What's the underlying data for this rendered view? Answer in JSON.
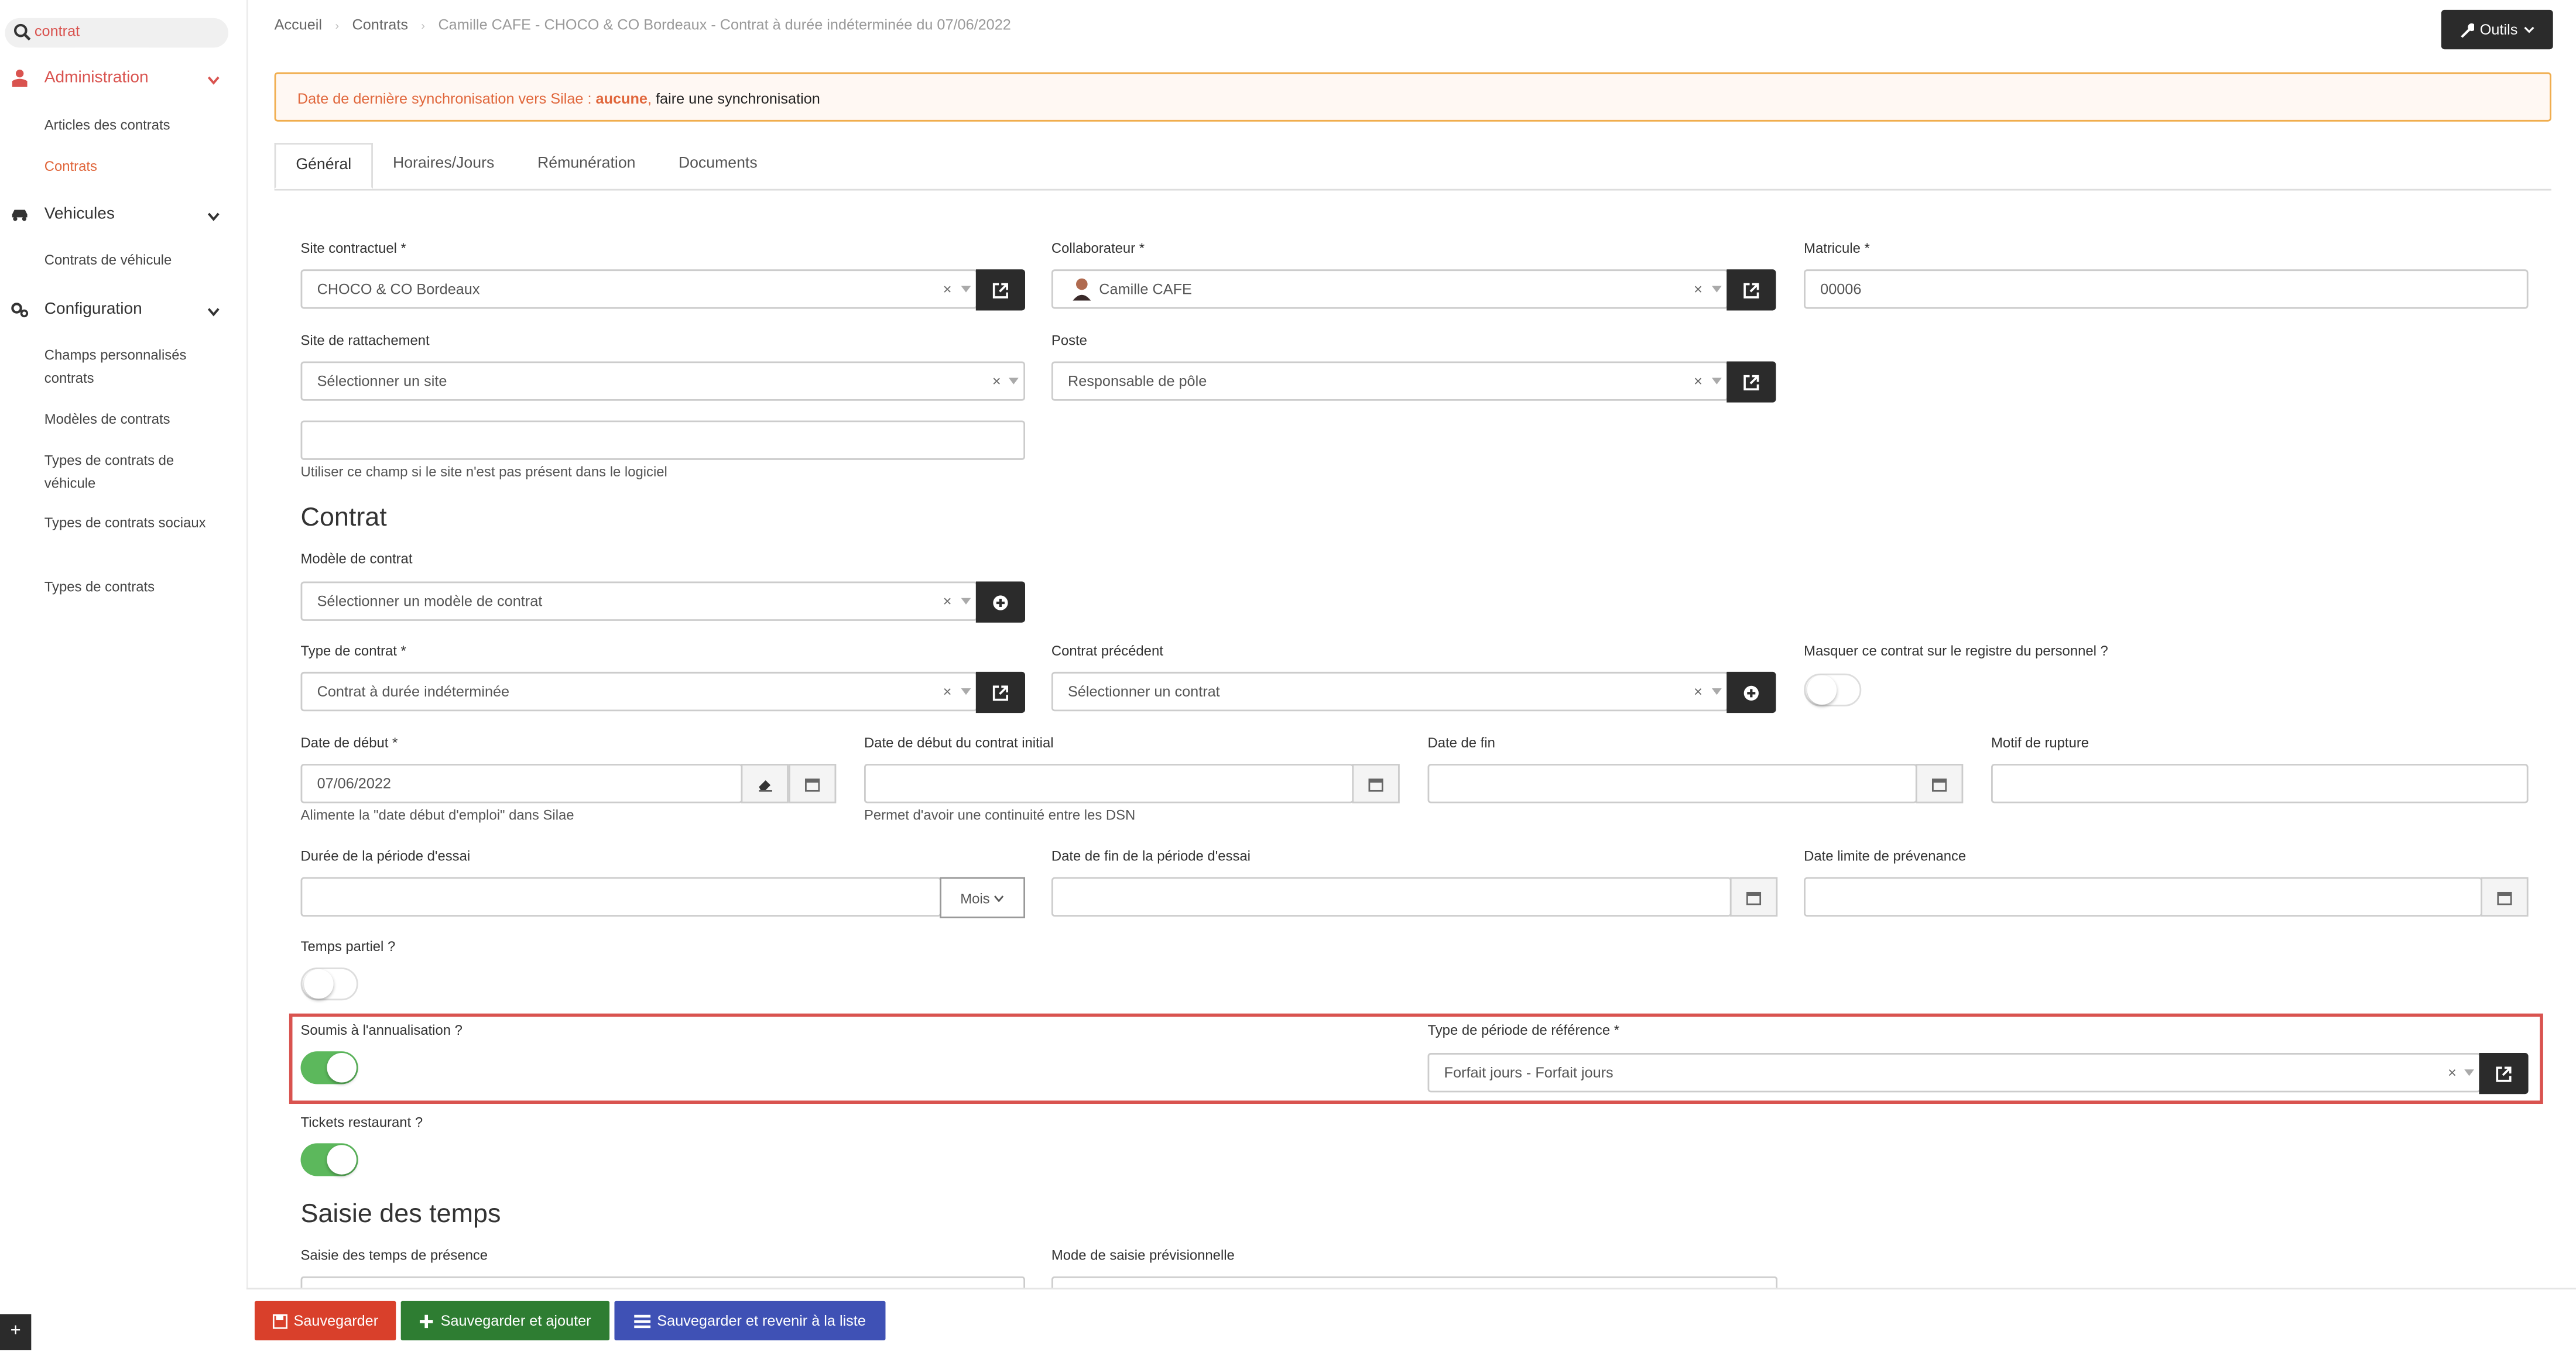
{
  "sidebar": {
    "search_value": "contrat",
    "sections": [
      {
        "label": "Administration",
        "icon": "user-tie-icon"
      },
      {
        "label": "Vehicules",
        "icon": "car-icon"
      },
      {
        "label": "Configuration",
        "icon": "cogs-icon"
      }
    ],
    "items": [
      "Articles des contrats",
      "Contrats",
      "Contrats de véhicule",
      "Champs personnalisés contrats",
      "Modèles de contrats",
      "Types de contrats de véhicule",
      "Types de contrats sociaux",
      "Types de contrats"
    ],
    "corner_label": "+"
  },
  "breadcrumb": {
    "home": "Accueil",
    "section": "Contrats",
    "current": "Camille CAFE - CHOCO & CO Bordeaux - Contrat à durée indéterminée du 07/06/2022"
  },
  "tools_button": "Outils",
  "alert": {
    "prefix": "Date de dernière synchronisation vers Silae : ",
    "status": "aucune",
    "suffix": ", ",
    "action": "faire une synchronisation"
  },
  "tabs": [
    "Général",
    "Horaires/Jours",
    "Rémunération",
    "Documents"
  ],
  "form": {
    "site_contractuel": {
      "label": "Site contractuel *",
      "value": "CHOCO & CO Bordeaux"
    },
    "collaborateur": {
      "label": "Collaborateur *",
      "value": "Camille CAFE"
    },
    "matricule": {
      "label": "Matricule *",
      "value": "00006"
    },
    "site_rattachement": {
      "label": "Site de rattachement",
      "placeholder": "Sélectionner un site"
    },
    "poste": {
      "label": "Poste",
      "value": "Responsable de pôle"
    },
    "site_libre_help": "Utiliser ce champ si le site n'est pas présent dans le logiciel",
    "section_contrat": "Contrat",
    "modele": {
      "label": "Modèle de contrat",
      "placeholder": "Sélectionner un modèle de contrat"
    },
    "type_contrat": {
      "label": "Type de contrat *",
      "value": "Contrat à durée indéterminée"
    },
    "contrat_precedent": {
      "label": "Contrat précédent",
      "placeholder": "Sélectionner un contrat"
    },
    "masquer": {
      "label": "Masquer ce contrat sur le registre du personnel ?",
      "on": false
    },
    "date_debut": {
      "label": "Date de début *",
      "value": "07/06/2022",
      "help": "Alimente la \"date début d'emploi\" dans Silae"
    },
    "date_debut_initial": {
      "label": "Date de début du contrat initial",
      "help": "Permet d'avoir une continuité entre les DSN"
    },
    "date_fin": {
      "label": "Date de fin"
    },
    "motif_rupture": {
      "label": "Motif de rupture"
    },
    "duree_essai": {
      "label": "Durée de la période d'essai",
      "unit": "Mois"
    },
    "date_fin_essai": {
      "label": "Date de fin de la période d'essai"
    },
    "date_prevenance": {
      "label": "Date limite de prévenance"
    },
    "temps_partiel": {
      "label": "Temps partiel ?",
      "on": false
    },
    "annualisation": {
      "label": "Soumis à l'annualisation ?",
      "on": true
    },
    "type_periode": {
      "label": "Type de période de référence *",
      "value": "Forfait jours - Forfait jours"
    },
    "tickets": {
      "label": "Tickets restaurant ?",
      "on": true
    },
    "section_saisie": "Saisie des temps",
    "saisie_presence": {
      "label": "Saisie des temps de présence"
    },
    "mode_saisie": {
      "label": "Mode de saisie prévisionnelle"
    }
  },
  "footer": {
    "save": "Sauvegarder",
    "save_add": "Sauvegarder et ajouter",
    "save_back": "Sauvegarder et revenir à la liste"
  },
  "colors": {
    "accent_red": "#d9534f",
    "accent_orange": "#e0663b",
    "toggle_on": "#5cb85c",
    "save_red": "#d9402b",
    "save_green": "#2e7d32",
    "save_blue": "#3f51b5",
    "dark_button": "#2b2b2b"
  }
}
